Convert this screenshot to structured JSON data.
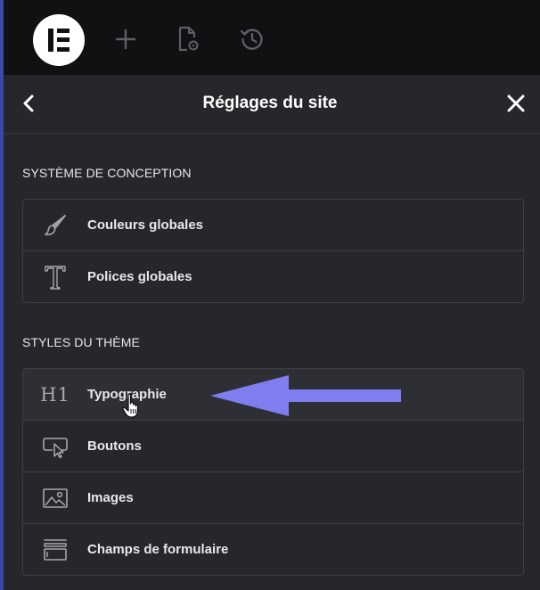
{
  "toolbar": {
    "logo": "elementor-logo",
    "icons": [
      "plus-icon",
      "page-settings-icon",
      "history-icon"
    ]
  },
  "header": {
    "title": "Réglages du site",
    "back_icon": "chevron-left-icon",
    "close_icon": "close-icon"
  },
  "sections": [
    {
      "title": "SYSTÈME DE CONCEPTION",
      "items": [
        {
          "label": "Couleurs globales",
          "icon": "brush-icon"
        },
        {
          "label": "Polices globales",
          "icon": "typeface-icon"
        }
      ]
    },
    {
      "title": "STYLES DU THÈME",
      "items": [
        {
          "label": "Typographie",
          "icon": "heading-icon",
          "glyph": "H1"
        },
        {
          "label": "Boutons",
          "icon": "button-icon"
        },
        {
          "label": "Images",
          "icon": "image-icon"
        },
        {
          "label": "Champs de formulaire",
          "icon": "form-field-icon"
        }
      ]
    }
  ],
  "colors": {
    "panel_bg": "#26272b",
    "toolbar_bg": "#111113",
    "annotation_arrow": "#7f7ef0",
    "text": "#e8e9ec",
    "icon": "#a6a8ae"
  }
}
